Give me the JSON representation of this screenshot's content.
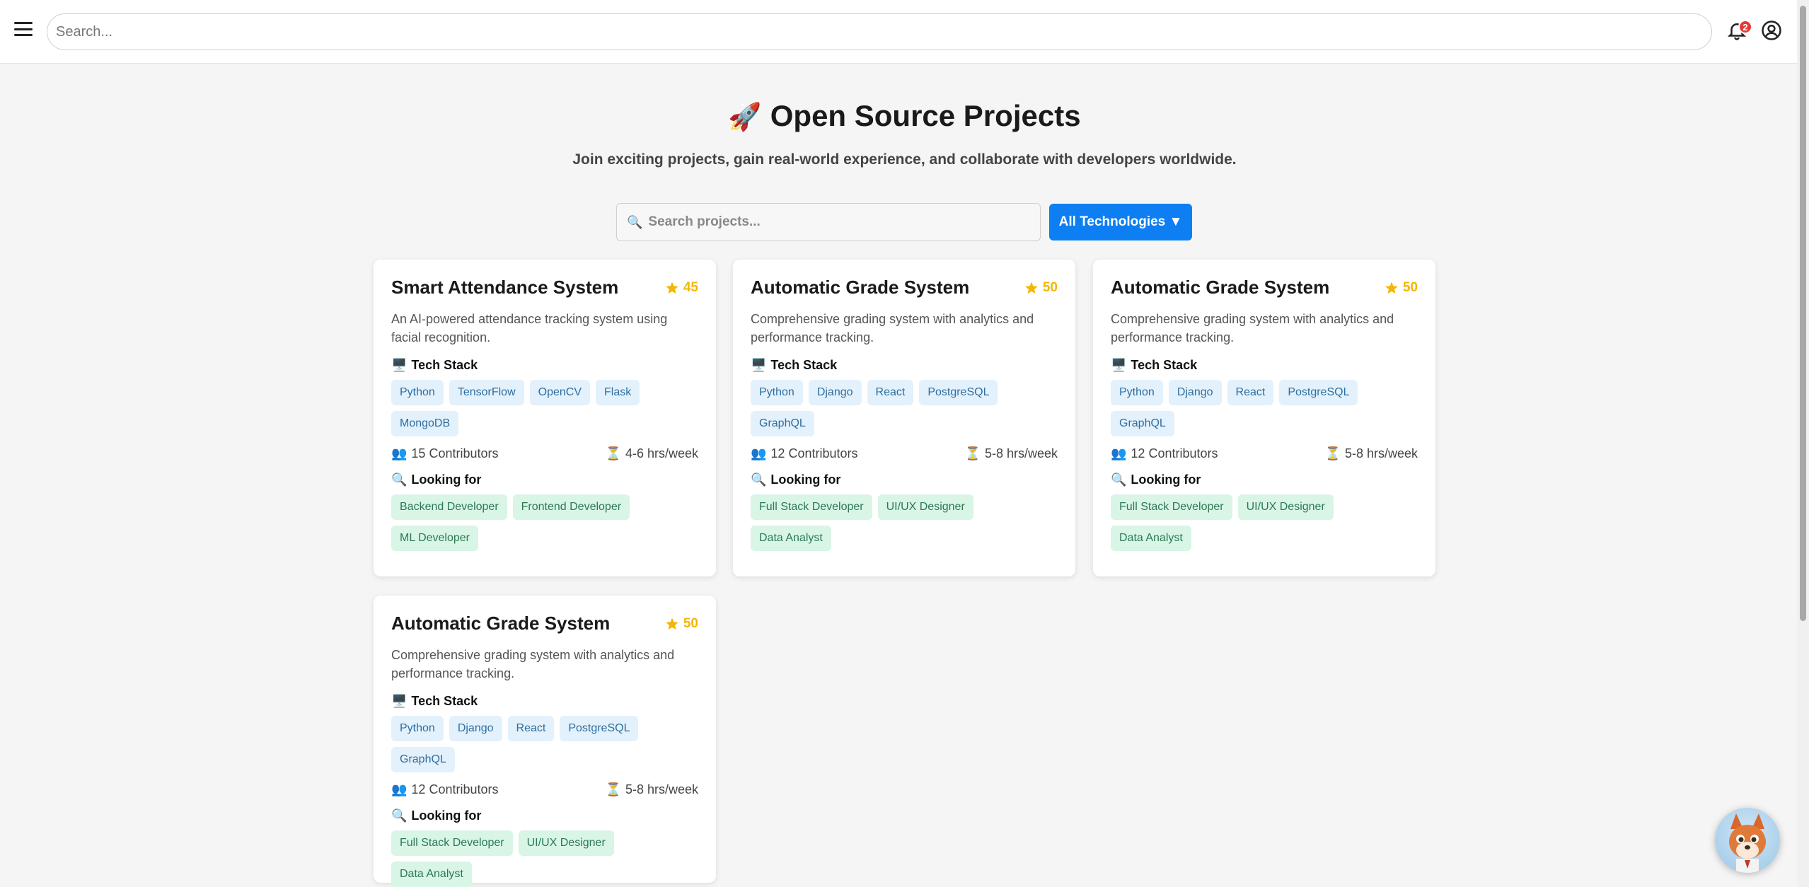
{
  "topbar": {
    "search_placeholder": "Search...",
    "notification_count": "2"
  },
  "header": {
    "title_icon": "🚀",
    "title": "Open Source Projects",
    "subtitle": "Join exciting projects, gain real-world experience, and collaborate with developers worldwide."
  },
  "filters": {
    "search_placeholder": "Search projects...",
    "tech_button": "All Technologies ▼"
  },
  "labels": {
    "tech_stack": "Tech Stack",
    "looking_for": "Looking for"
  },
  "projects": [
    {
      "title": "Smart Attendance System",
      "stars": "45",
      "description": "An AI-powered attendance tracking system using facial recognition.",
      "tech": [
        "Python",
        "TensorFlow",
        "OpenCV",
        "Flask",
        "MongoDB"
      ],
      "contributors": "15 Contributors",
      "hours": "4-6 hrs/week",
      "roles": [
        "Backend Developer",
        "Frontend Developer",
        "ML Developer"
      ]
    },
    {
      "title": "Automatic Grade System",
      "stars": "50",
      "description": "Comprehensive grading system with analytics and performance tracking.",
      "tech": [
        "Python",
        "Django",
        "React",
        "PostgreSQL",
        "GraphQL"
      ],
      "contributors": "12 Contributors",
      "hours": "5-8 hrs/week",
      "roles": [
        "Full Stack Developer",
        "UI/UX Designer",
        "Data Analyst"
      ]
    },
    {
      "title": "Automatic Grade System",
      "stars": "50",
      "description": "Comprehensive grading system with analytics and performance tracking.",
      "tech": [
        "Python",
        "Django",
        "React",
        "PostgreSQL",
        "GraphQL"
      ],
      "contributors": "12 Contributors",
      "hours": "5-8 hrs/week",
      "roles": [
        "Full Stack Developer",
        "UI/UX Designer",
        "Data Analyst"
      ]
    },
    {
      "title": "Automatic Grade System",
      "stars": "50",
      "description": "Comprehensive grading system with analytics and performance tracking.",
      "tech": [
        "Python",
        "Django",
        "React",
        "PostgreSQL",
        "GraphQL"
      ],
      "contributors": "12 Contributors",
      "hours": "5-8 hrs/week",
      "roles": [
        "Full Stack Developer",
        "UI/UX Designer",
        "Data Analyst"
      ]
    }
  ],
  "colors": {
    "accent": "#0d7ff2",
    "star": "#f2b705",
    "tech_tag_bg": "#e3f1fc",
    "role_tag_bg": "#d8f5e6",
    "badge": "#e53935"
  }
}
